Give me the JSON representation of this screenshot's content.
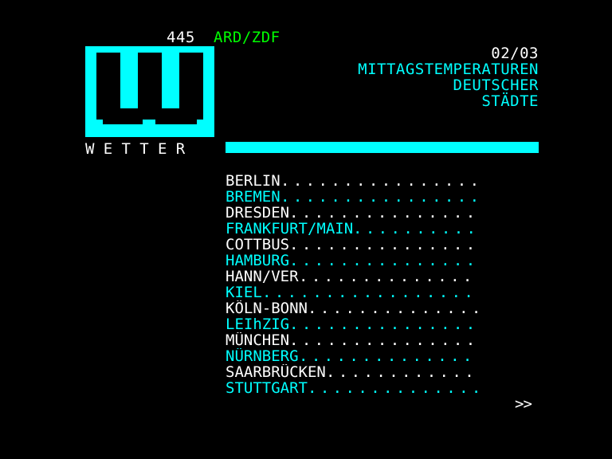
{
  "header": {
    "page_number": "445",
    "service": "ARD/ZDF",
    "subpage": "02/03",
    "title_lines": [
      "MITTAGSTEMPERATUREN",
      "DEUTSCHER",
      "STÄDTE"
    ],
    "section_label": "WETTER",
    "logo_letter": "W"
  },
  "cities": [
    {
      "name": "BERLIN",
      "color": "white"
    },
    {
      "name": "BREMEN",
      "color": "cyan"
    },
    {
      "name": "DRESDEN",
      "color": "white"
    },
    {
      "name": "FRANKFURT/MAIN",
      "color": "cyan"
    },
    {
      "name": "COTTBUS",
      "color": "white"
    },
    {
      "name": "HAMBURG",
      "color": "cyan"
    },
    {
      "name": "HANN/VER",
      "color": "white"
    },
    {
      "name": "KIEL",
      "color": "cyan"
    },
    {
      "name": "KÖLN-BONN",
      "color": "white"
    },
    {
      "name": "LEIhZIG",
      "color": "cyan"
    },
    {
      "name": "MÜNCHEN",
      "color": "white"
    },
    {
      "name": "NÜRNBERG",
      "color": "cyan"
    },
    {
      "name": "SAARBRÜCKEN",
      "color": "white"
    },
    {
      "name": "STUTTGART",
      "color": "cyan"
    }
  ],
  "navigation": {
    "next_label": ">>"
  },
  "colors": {
    "background": "#000000",
    "white": "#ffffff",
    "cyan": "#00ffff",
    "green": "#00ff00"
  }
}
